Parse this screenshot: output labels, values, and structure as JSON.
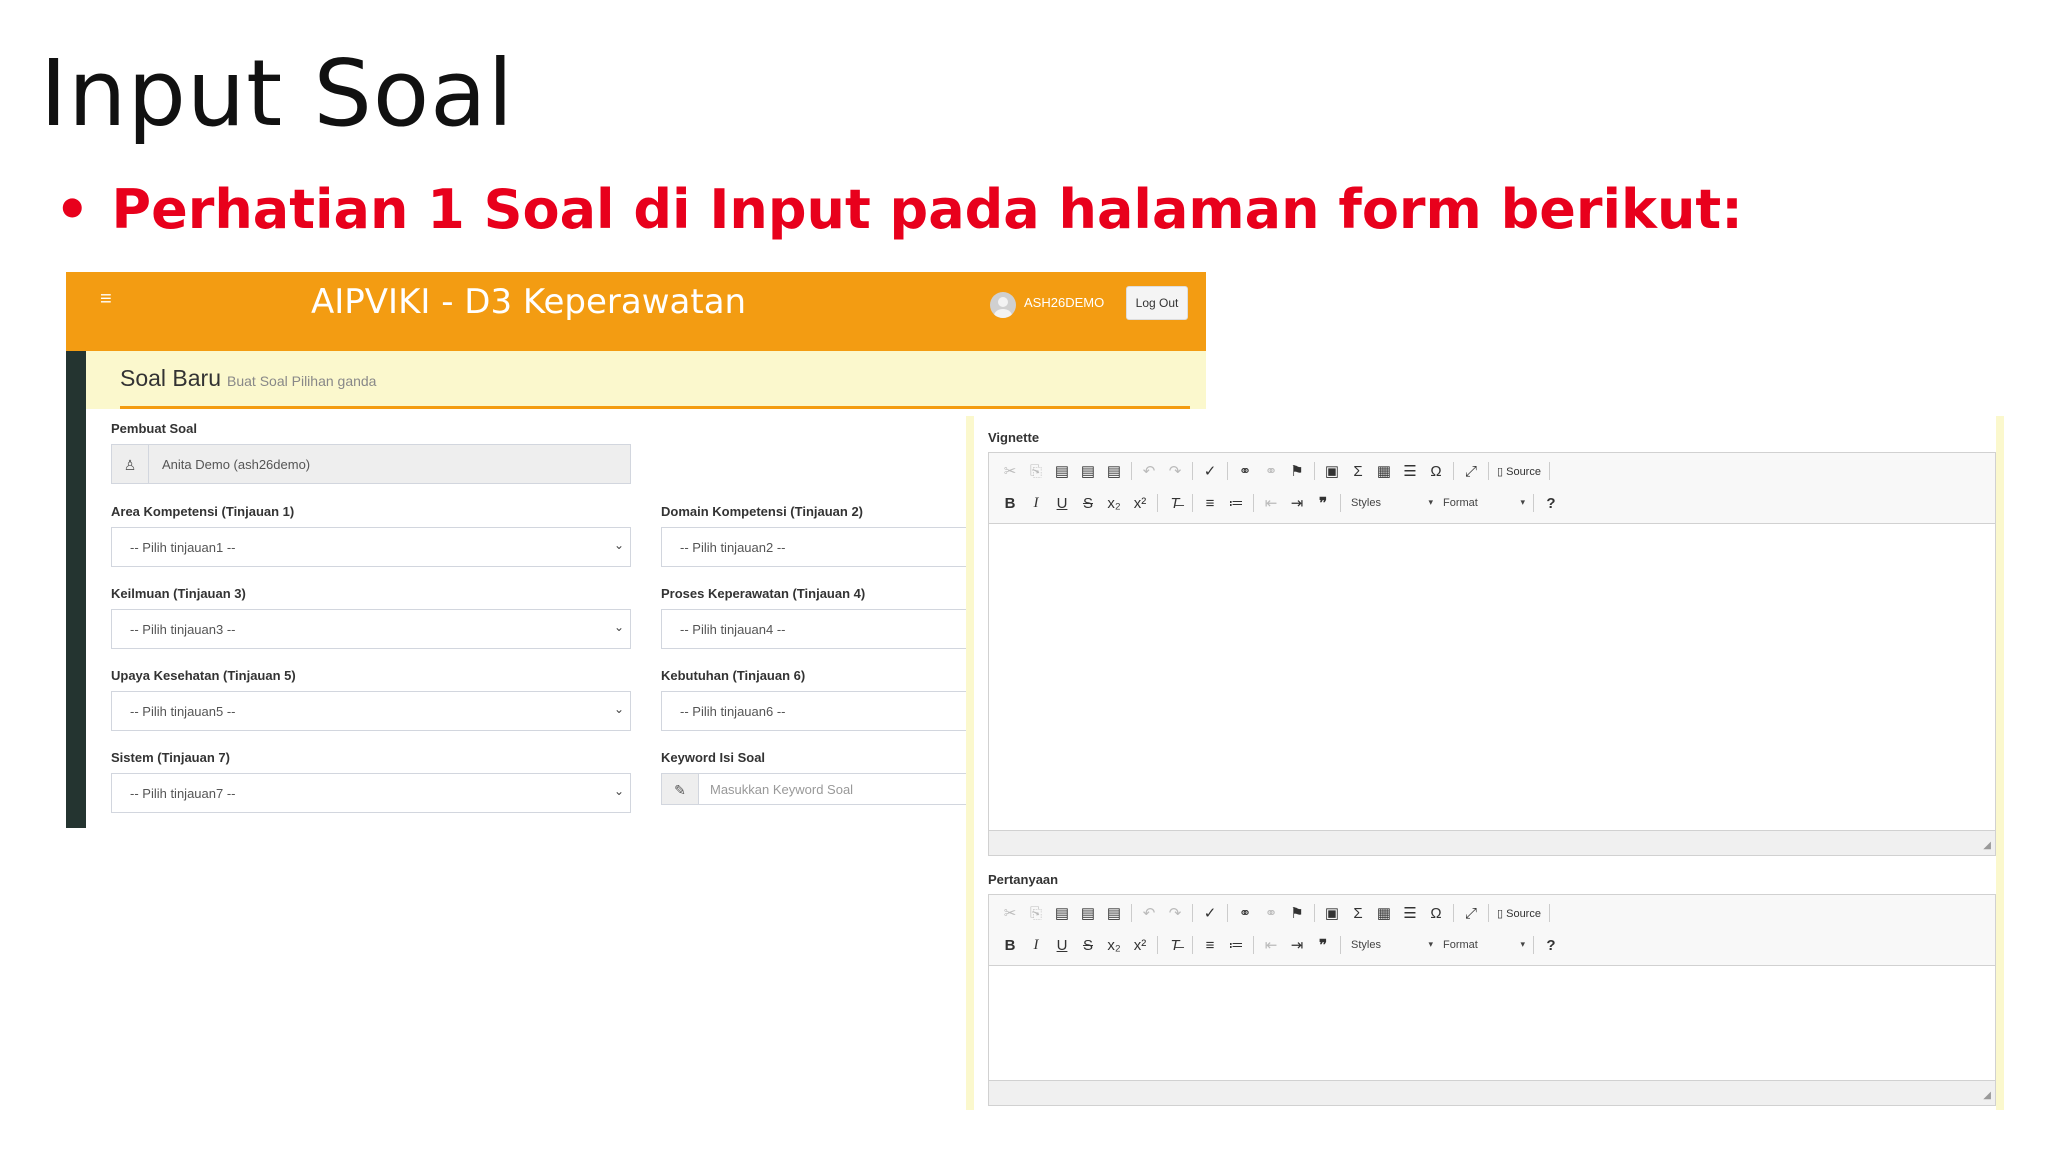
{
  "slide": {
    "title": "Input Soal",
    "bullet_mark": "•",
    "bullet": "Perhatian 1 Soal di Input pada halaman form berikut:"
  },
  "app": {
    "menu_icon": "≡",
    "title": "AIPVIKI - D3 Keperawatan",
    "username": "ASH26DEMO",
    "logout_label": "Log Out",
    "accent_color": "#f39c12"
  },
  "page": {
    "heading": "Soal Baru",
    "subheading": "Buat Soal Pilihan ganda"
  },
  "form": {
    "pembuat_label": "Pembuat Soal",
    "pembuat_value": "Anita Demo (ash26demo)",
    "t1_label": "Area Kompetensi (Tinjauan 1)",
    "t1_value": "-- Pilih tinjauan1 --",
    "t2_label": "Domain Kompetensi (Tinjauan 2)",
    "t2_value": "-- Pilih tinjauan2 --",
    "t3_label": "Keilmuan (Tinjauan 3)",
    "t3_value": "-- Pilih tinjauan3 --",
    "t4_label": "Proses Keperawatan (Tinjauan 4)",
    "t4_value": "-- Pilih tinjauan4 --",
    "t5_label": "Upaya Kesehatan (Tinjauan 5)",
    "t5_value": "-- Pilih tinjauan5 --",
    "t6_label": "Kebutuhan (Tinjauan 6)",
    "t6_value": "-- Pilih tinjauan6 --",
    "t7_label": "Sistem (Tinjauan 7)",
    "t7_value": "-- Pilih tinjauan7 --",
    "keyword_label": "Keyword Isi Soal",
    "keyword_placeholder": "Masukkan Keyword Soal"
  },
  "editors": {
    "vignette_label": "Vignette",
    "pertanyaan_label": "Pertanyaan",
    "source_label": "Source",
    "styles_label": "Styles",
    "format_label": "Format",
    "help_label": "?"
  }
}
